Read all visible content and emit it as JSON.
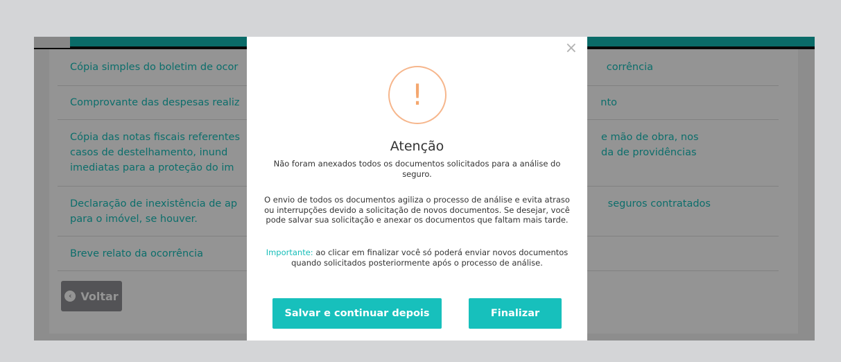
{
  "page": {
    "documents": [
      {
        "lines": [
          "Cópia simples do boletim de ocor",
          "corrência"
        ]
      },
      {
        "lines": [
          "Comprovante das despesas realiz",
          "nto"
        ]
      },
      {
        "lines": [
          "Cópia das notas fiscais referentes",
          "e mão de obra, nos",
          "casos de destelhamento, inund",
          "da de providências",
          "imediatas para a proteção do im"
        ]
      },
      {
        "lines": [
          "Declaração de inexistência de ap",
          "seguros contratados",
          "para o imóvel, se houver."
        ]
      },
      {
        "lines": [
          "Breve relato da ocorrência"
        ]
      }
    ],
    "back_label": "Voltar"
  },
  "modal": {
    "close_icon": "×",
    "warning_icon": "!",
    "title": "Atenção",
    "paragraph1": "Não foram anexados todos os documentos solicitados para a análise do seguro.",
    "paragraph2": "O envio de todos os documentos agiliza o processo de análise e evita atraso ou interrupções devido a solicitação de novos documentos. Se desejar, você pode salvar sua solicitação e anexar os documentos que faltam mais tarde.",
    "important_label": "Importante:",
    "paragraph3": " ao clicar em finalizar você só poderá enviar novos documentos quando solicitados posteriormente após o processo de análise.",
    "save_button": "Salvar e continuar depois",
    "finish_button": "Finalizar"
  },
  "colors": {
    "accent": "#17c0bc",
    "warning": "#f4a76f",
    "back_button": "#8f9094"
  }
}
